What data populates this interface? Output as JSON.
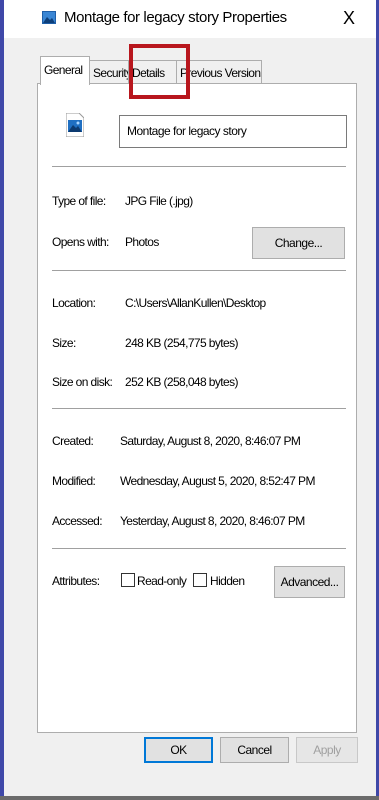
{
  "window": {
    "title": "Montage for legacy story Properties",
    "close_label": "X"
  },
  "tabs": [
    {
      "label": "General",
      "active": true
    },
    {
      "label": "Security",
      "active": false
    },
    {
      "label": "Details",
      "active": false
    },
    {
      "label": "Previous Versions",
      "active": false
    }
  ],
  "file": {
    "name": "Montage  for legacy story"
  },
  "info": {
    "type_label": "Type of file:",
    "type_value": "JPG File (.jpg)",
    "opens_label": "Opens with:",
    "opens_value": "Photos",
    "change_button": "Change...",
    "location_label": "Location:",
    "location_value": "C:\\Users\\AllanKullen\\Desktop",
    "size_label": "Size:",
    "size_value": "248 KB (254,775 bytes)",
    "size_on_disk_label": "Size on disk:",
    "size_on_disk_value": "252 KB (258,048 bytes)",
    "created_label": "Created:",
    "created_value": "Saturday, August 8, 2020, 8:46:07 PM",
    "modified_label": "Modified:",
    "modified_value": "Wednesday, August 5, 2020, 8:52:47 PM",
    "accessed_label": "Accessed:",
    "accessed_value": "Yesterday, August 8, 2020, 8:46:07 PM",
    "attributes_label": "Attributes:",
    "readonly_label": "Read-only",
    "hidden_label": "Hidden",
    "advanced_button": "Advanced..."
  },
  "footer": {
    "ok": "OK",
    "cancel": "Cancel",
    "apply": "Apply"
  },
  "colors": {
    "highlight": "#b8161d",
    "frame": "#3f48a8"
  }
}
